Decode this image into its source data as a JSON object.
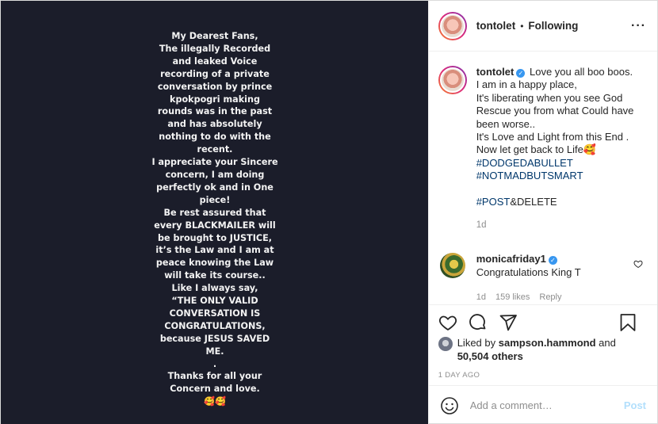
{
  "media": {
    "lines": [
      "My Dearest Fans,",
      "The illegally Recorded",
      "and leaked Voice",
      "recording of a private",
      "conversation by prince",
      "kpokpogri making",
      "rounds was in the past",
      "and has absolutely",
      "nothing to do with the",
      "recent.",
      "I appreciate your Sincere",
      "concern, I am doing",
      "perfectly ok and in One",
      "piece!",
      "Be rest assured that",
      "every BLACKMAILER will",
      "be brought to JUSTICE,",
      "it’s the Law and I am at",
      "peace knowing the Law",
      "will take its course..",
      "Like I always say,",
      "“THE ONLY VALID",
      "CONVERSATION IS",
      "CONGRATULATIONS,",
      "because JESUS SAVED",
      "ME.",
      ".",
      "Thanks for all your",
      "Concern and love.",
      "🥰🥰"
    ]
  },
  "header": {
    "username": "tontolet",
    "separator": "•",
    "follow_label": "Following",
    "more_icon": "···"
  },
  "caption": {
    "username": "tontolet",
    "verified": "✓",
    "lines": [
      "Love you all boo boos.",
      "I am in a happy place,",
      "It's liberating when you see God",
      "Rescue you from what Could have",
      "been worse..",
      "It's Love and Light from this End .",
      "Now let get back to Life🥰"
    ],
    "hashtags": [
      "#DODGEDABULLET",
      "#NOTMADBUTSMART"
    ],
    "hashtag3_tag": "#POST",
    "hashtag3_rest": "&DELETE",
    "age": "1d"
  },
  "comment": {
    "username": "monicafriday1",
    "verified": "✓",
    "text": "Congratulations King T",
    "age": "1d",
    "likes": "159 likes",
    "reply_label": "Reply"
  },
  "actions": {
    "liked_prefix": "Liked by",
    "liked_user": "sampson.hammond",
    "liked_and": "and",
    "liked_others": "50,504 others",
    "timestamp": "1 DAY AGO"
  },
  "add_comment": {
    "placeholder": "Add a comment…",
    "post_label": "Post"
  },
  "icons": {
    "heart": "heart-icon",
    "comment": "comment-icon",
    "share": "share-icon",
    "bookmark": "bookmark-icon",
    "emoji": "emoji-icon"
  },
  "colors": {
    "link": "#00376b",
    "verified": "#3897f0",
    "post_button": "#b2dffc",
    "media_bg": "#1b1d2a"
  }
}
